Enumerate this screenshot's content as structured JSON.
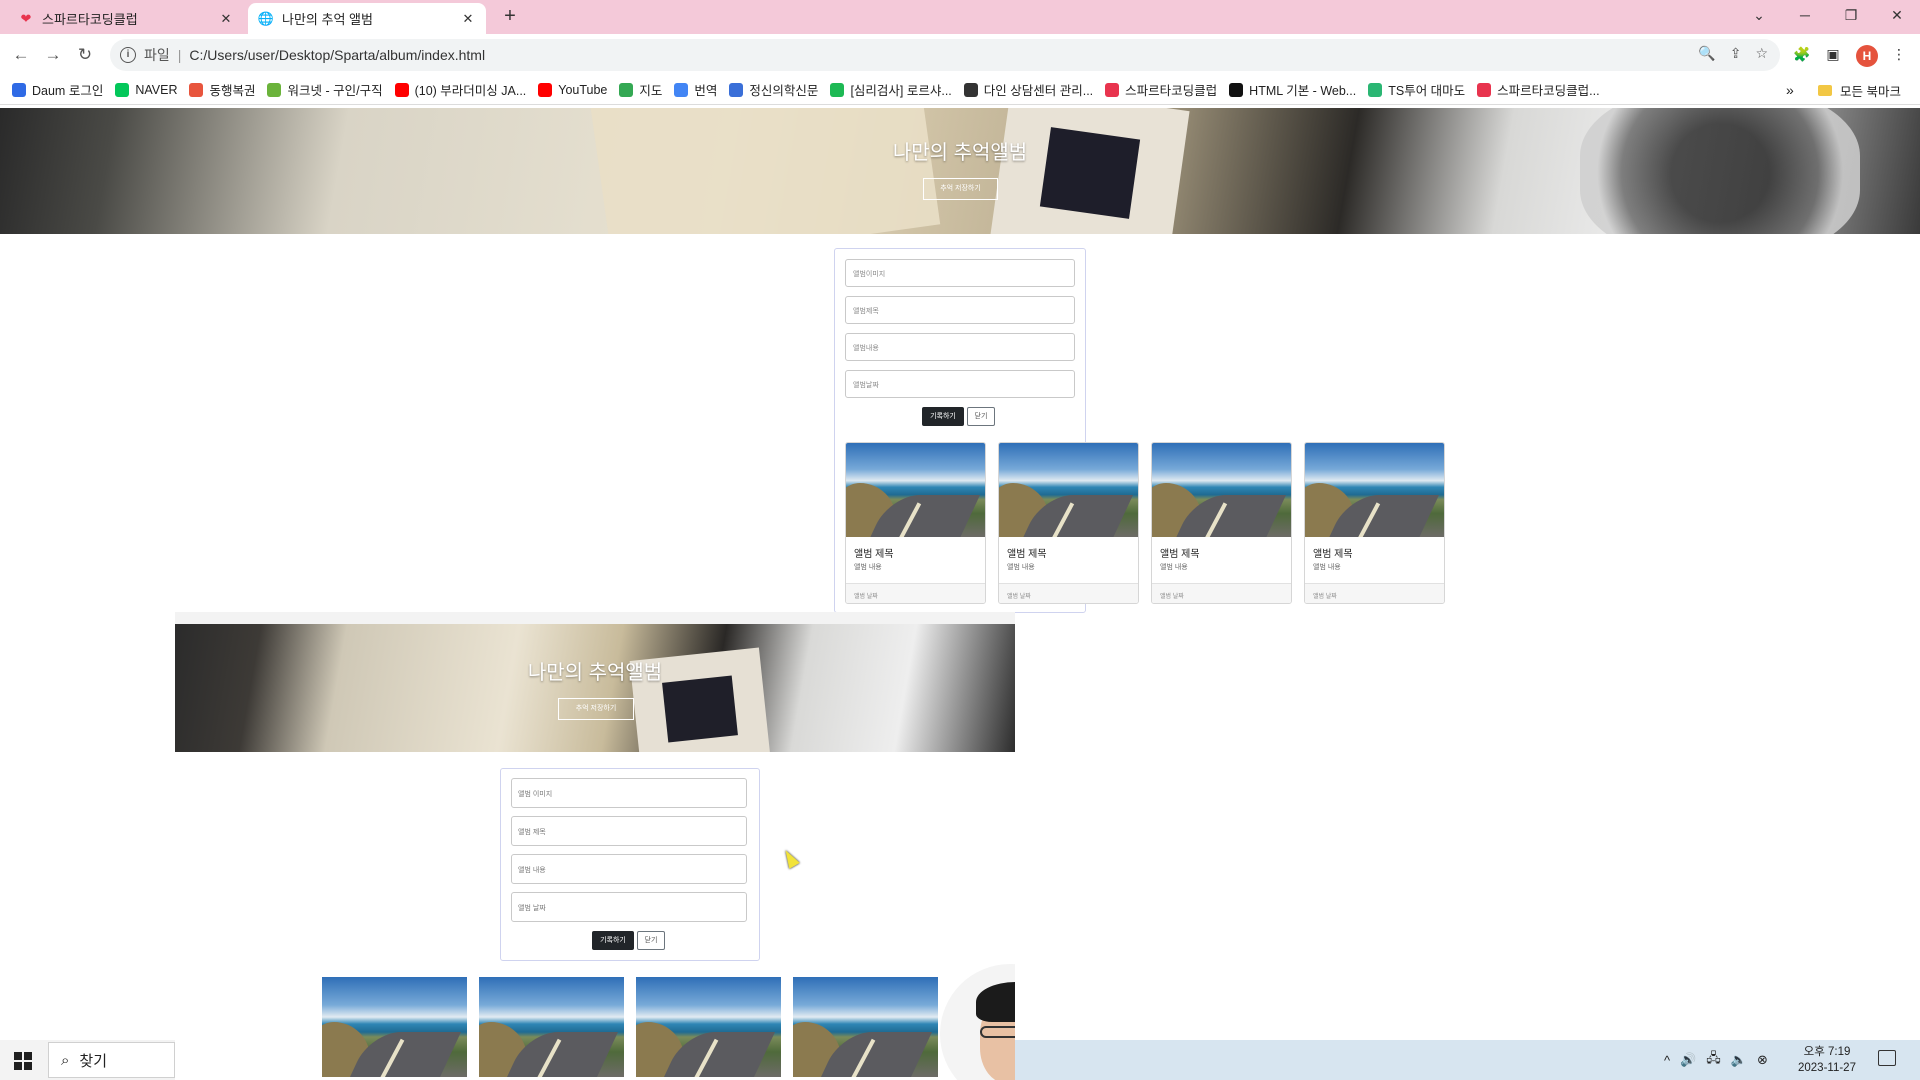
{
  "browser": {
    "tabs": [
      {
        "title": "스파르타코딩클럽",
        "icon": "heart-icon",
        "active": false
      },
      {
        "title": "나만의 추억 앨범",
        "icon": "globe-icon",
        "active": true
      }
    ],
    "address": {
      "scheme_label": "파일",
      "url": "C:/Users/user/Desktop/Sparta/album/index.html"
    },
    "avatar_letter": "H",
    "bookmarks": [
      {
        "label": "Daum 로그인",
        "icon": "daum-icon",
        "color": "#2f6ae5"
      },
      {
        "label": "NAVER",
        "icon": "naver-icon",
        "color": "#03c75a"
      },
      {
        "label": "동행복권",
        "icon": "lotto-icon",
        "color": "#e8553d"
      },
      {
        "label": "워크넷 - 구인/구직",
        "icon": "worknet-icon",
        "color": "#6bb33b"
      },
      {
        "label": "(10) 부라더미싱 JA...",
        "icon": "youtube-icon",
        "color": "#ff0000"
      },
      {
        "label": "YouTube",
        "icon": "youtube-icon",
        "color": "#ff0000"
      },
      {
        "label": "지도",
        "icon": "maps-icon",
        "color": "#34a853"
      },
      {
        "label": "번역",
        "icon": "translate-icon",
        "color": "#4285f4"
      },
      {
        "label": "정신의학신문",
        "icon": "news-icon",
        "color": "#3a6fd8"
      },
      {
        "label": "[심리검사] 로르샤...",
        "icon": "chat-icon",
        "color": "#1db954"
      },
      {
        "label": "다인 상담센터 관리...",
        "icon": "globe-icon",
        "color": "#333333"
      },
      {
        "label": "스파르타코딩클럽",
        "icon": "heart-icon",
        "color": "#e8344e"
      },
      {
        "label": "HTML 기본 - Web...",
        "icon": "mdn-icon",
        "color": "#111111"
      },
      {
        "label": "TS투어 대마도",
        "icon": "ts-icon",
        "color": "#2bb673"
      },
      {
        "label": "스파르타코딩클럽...",
        "icon": "heart-icon",
        "color": "#e8344e"
      }
    ],
    "bookmarks_more": "»",
    "all_bookmarks": "모든 북마크"
  },
  "page": {
    "hero_title": "나만의 추억앨범",
    "hero_button": "추억 저장하기",
    "form": {
      "fields": [
        "앨범이미지",
        "앨범제목",
        "앨범내용",
        "앨범날짜"
      ],
      "submit": "기록하기",
      "close": "닫기"
    },
    "cards": [
      {
        "title": "앨범 제목",
        "content": "앨범 내용",
        "date": "앨범 날짜"
      },
      {
        "title": "앨범 제목",
        "content": "앨범 내용",
        "date": "앨범 날짜"
      },
      {
        "title": "앨범 제목",
        "content": "앨범 내용",
        "date": "앨범 날짜"
      },
      {
        "title": "앨범 제목",
        "content": "앨범 내용",
        "date": "앨범 날짜"
      }
    ]
  },
  "overlay": {
    "hero_title": "나만의 추억앨범",
    "hero_button": "추억 저장하기",
    "form": {
      "fields": [
        "앨범 이미지",
        "앨범 제목",
        "앨범 내용",
        "앨범 날짜"
      ],
      "submit": "기록하기",
      "close": "닫기"
    }
  },
  "taskbar": {
    "search_label": "찾기",
    "time": "오후 7:19",
    "date": "2023-11-27"
  }
}
